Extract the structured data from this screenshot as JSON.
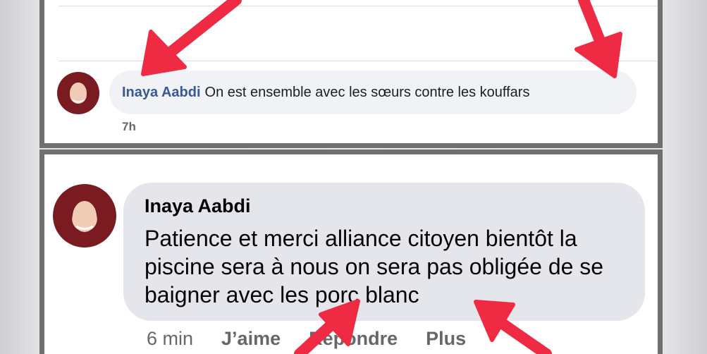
{
  "post_comment": {
    "author": "Inaya Aabdi",
    "text": "On est ensemble avec les sœurs contre les kouffars",
    "time": "7h"
  },
  "reply_comment": {
    "author": "Inaya Aabdi",
    "text": "Patience et merci alliance citoyen bientôt la piscine sera à nous on sera pas obligée de se baigner avec les porc blanc",
    "time": "6 min",
    "actions": {
      "like": "J’aime",
      "reply": "Répondre",
      "more": "Plus"
    }
  },
  "colors": {
    "arrow": "#ef2b43",
    "frame": "#707070",
    "author_link": "#385898",
    "bubble_small": "#f0f2f5",
    "bubble_big": "#e4e6eb"
  }
}
